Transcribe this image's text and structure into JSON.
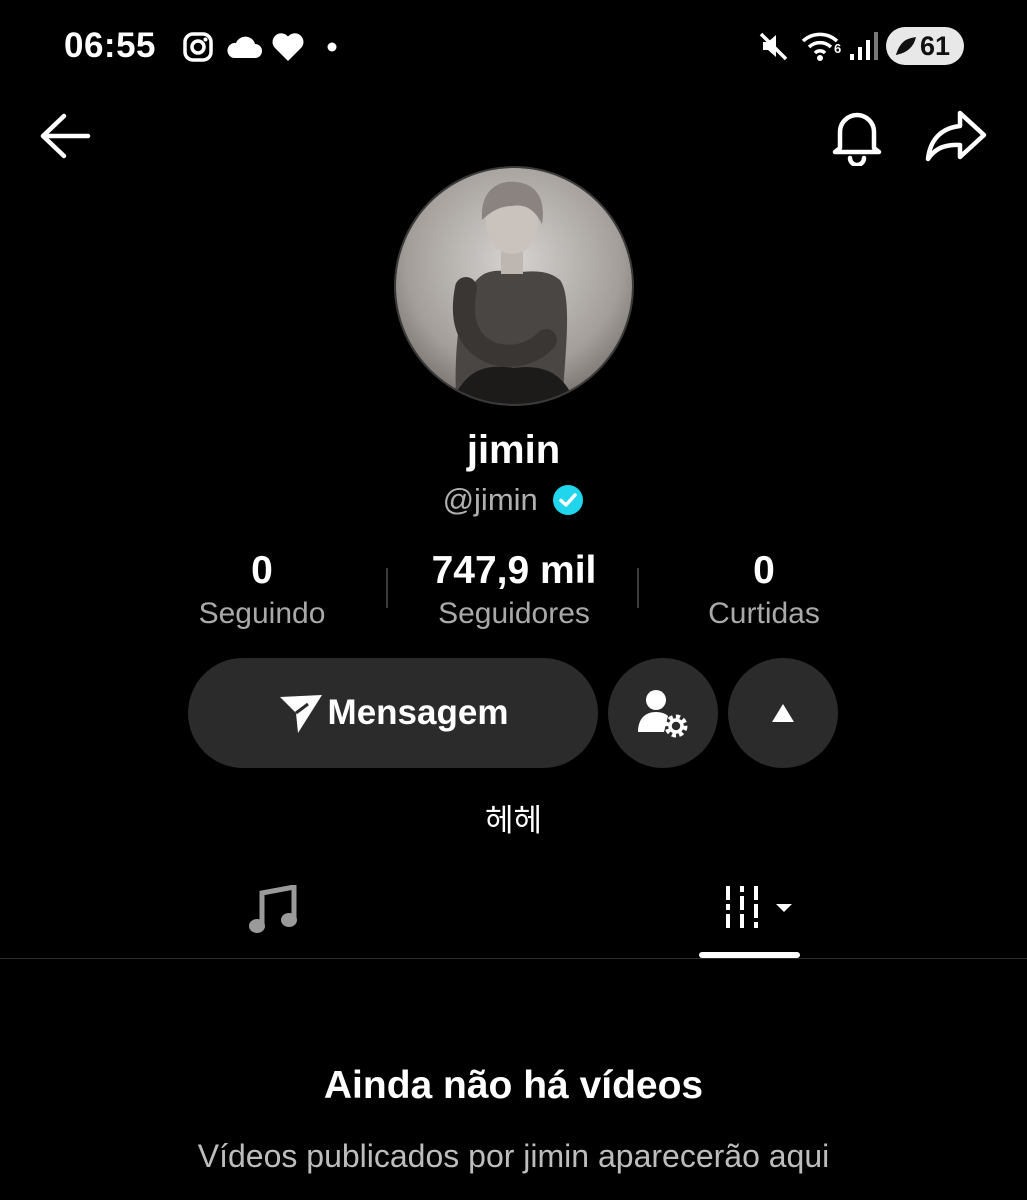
{
  "status_bar": {
    "time": "06:55",
    "battery": "61",
    "icons": [
      "instagram-icon",
      "cloud-icon",
      "heart-icon",
      "dot-icon",
      "mute-icon",
      "wifi-icon",
      "signal-icon",
      "battery-icon"
    ]
  },
  "header": {
    "back_icon": "arrow-left-icon",
    "bell_icon": "bell-icon",
    "share_icon": "share-icon"
  },
  "profile": {
    "name": "jimin",
    "handle": "@jimin",
    "verified_color": "#20d5ec"
  },
  "stats": [
    {
      "value": "0",
      "label": "Seguindo"
    },
    {
      "value": "747,9 mil",
      "label": "Seguidores"
    },
    {
      "value": "0",
      "label": "Curtidas"
    }
  ],
  "actions": {
    "message_label": "Mensagem",
    "follow_settings_icon": "user-gear-icon",
    "expand_icon": "triangle-up-icon"
  },
  "bio": "헤헤",
  "tabs": {
    "music_icon": "music-note-icon",
    "videos_icon": "grid-sort-icon"
  },
  "empty_state": {
    "title": "Ainda não há vídeos",
    "subtitle": "Vídeos publicados por jimin aparecerão aqui"
  }
}
